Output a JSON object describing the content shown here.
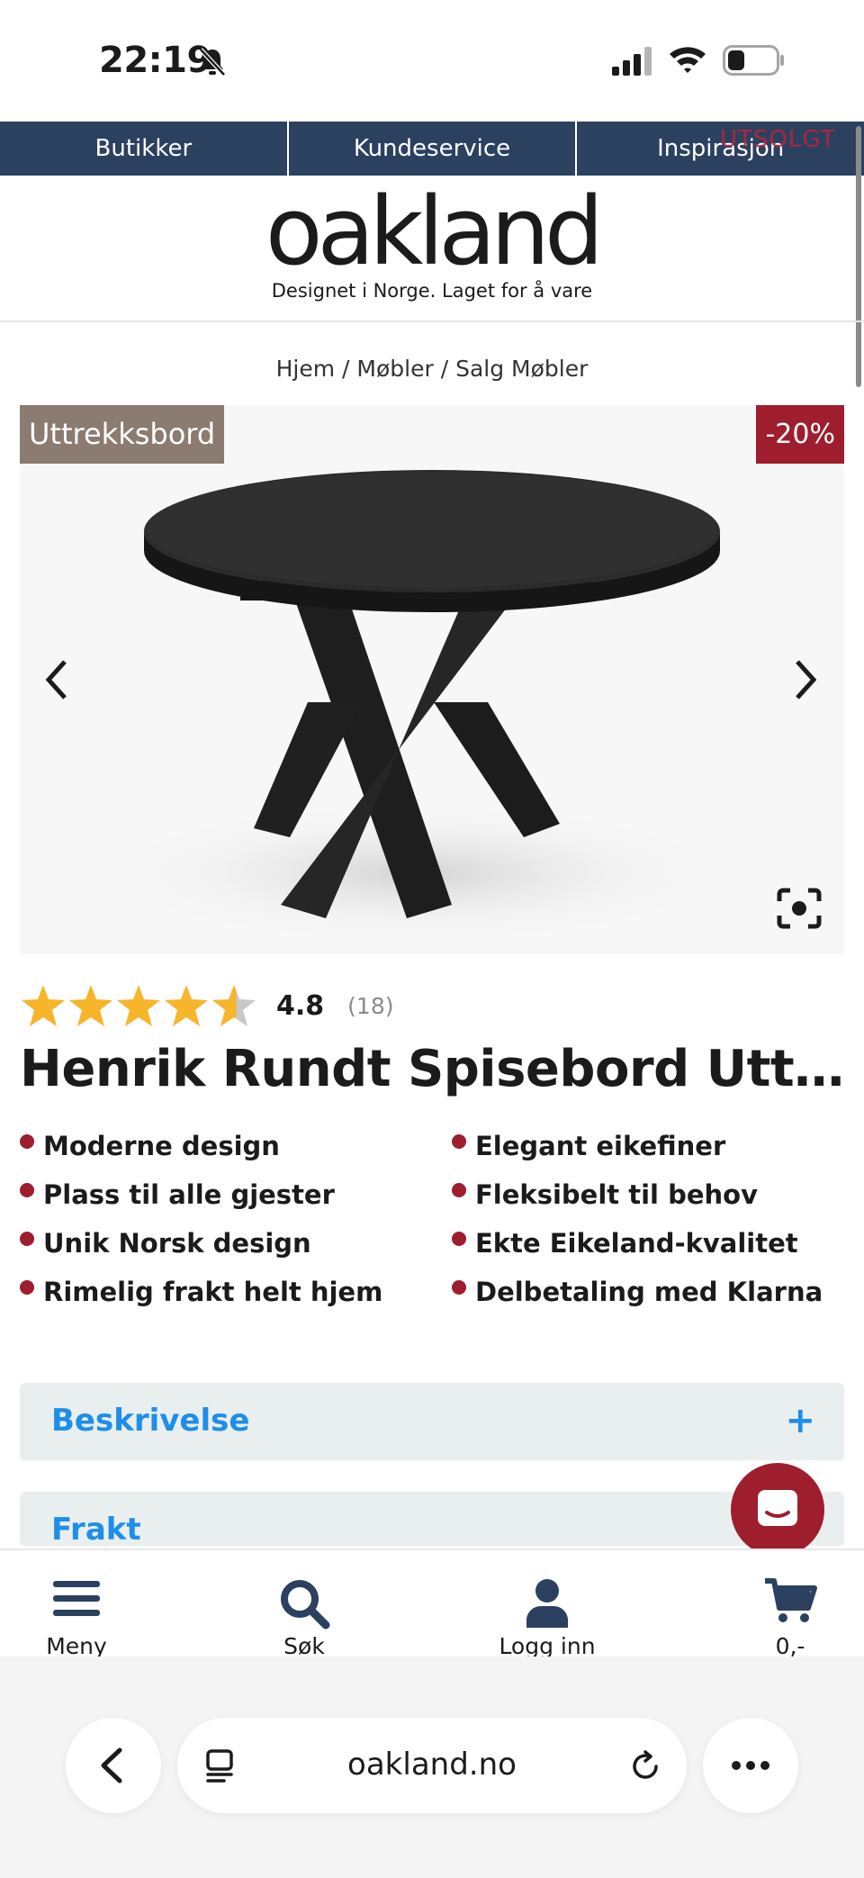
{
  "status_bar": {
    "time": "22:19"
  },
  "top_nav": {
    "items": [
      "Butikker",
      "Kundeservice",
      "Inspirasjon"
    ],
    "overlay": "UTSOLGT"
  },
  "logo": {
    "name": "oakland",
    "tagline": "Designet i Norge. Laget for å vare"
  },
  "breadcrumb": "Hjem / Møbler / Salg Møbler",
  "product": {
    "category_badge": "Uttrekksbord",
    "discount_badge": "-20%",
    "rating": {
      "value": 4.8,
      "value_text": "4.8",
      "count_text": "(18)",
      "max": 5
    },
    "title": "Henrik Rundt Spisebord Uttrekksbord",
    "features": [
      "Moderne design",
      "Elegant eikefiner",
      "Plass til alle gjester",
      "Fleksibelt til behov",
      "Unik Norsk design",
      "Ekte Eikeland-kvalitet",
      "Rimelig frakt helt hjem",
      "Delbetaling med Klarna"
    ]
  },
  "accordions": [
    {
      "title": "Beskrivelse",
      "toggle": "+"
    },
    {
      "title": "Frakt",
      "toggle": "+"
    }
  ],
  "bottom_nav": {
    "menu": "Meny",
    "search": "Søk",
    "login": "Logg inn",
    "cart": "0,-"
  },
  "browser": {
    "url": "oakland.no"
  },
  "colors": {
    "nav_bg": "#2c4160",
    "brand_red": "#9e1e2e",
    "badge_brown": "#8b7b70",
    "accent_blue": "#1e8ee8",
    "star_gold": "#f7b52c"
  }
}
